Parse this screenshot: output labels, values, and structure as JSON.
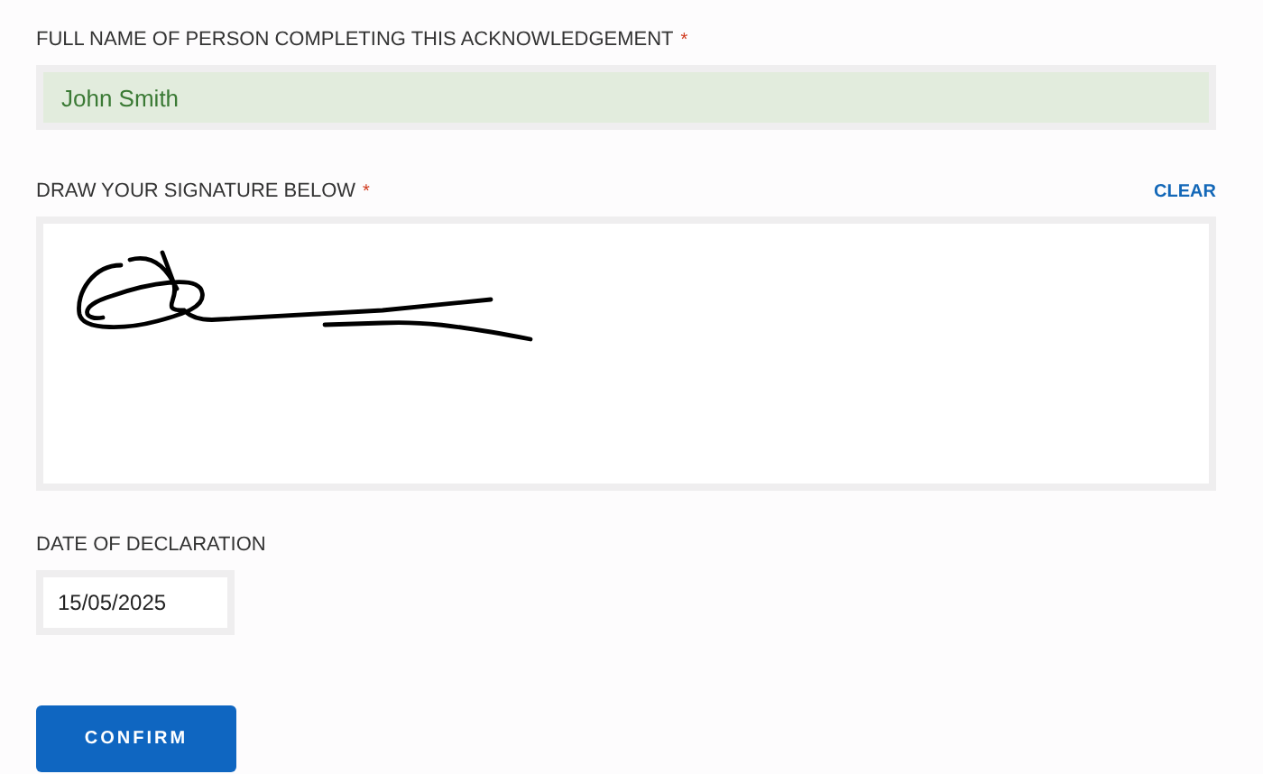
{
  "full_name": {
    "label": "FULL NAME OF PERSON COMPLETING THIS ACKNOWLEDGEMENT",
    "required_mark": "*",
    "value": "John Smith",
    "valid": true
  },
  "signature": {
    "label": "DRAW YOUR SIGNATURE BELOW",
    "required_mark": "*",
    "clear_link": "CLEAR",
    "signed": true
  },
  "date": {
    "label": "DATE OF DECLARATION",
    "value": "15/05/2025"
  },
  "buttons": [
    "CONFIRM"
  ]
}
